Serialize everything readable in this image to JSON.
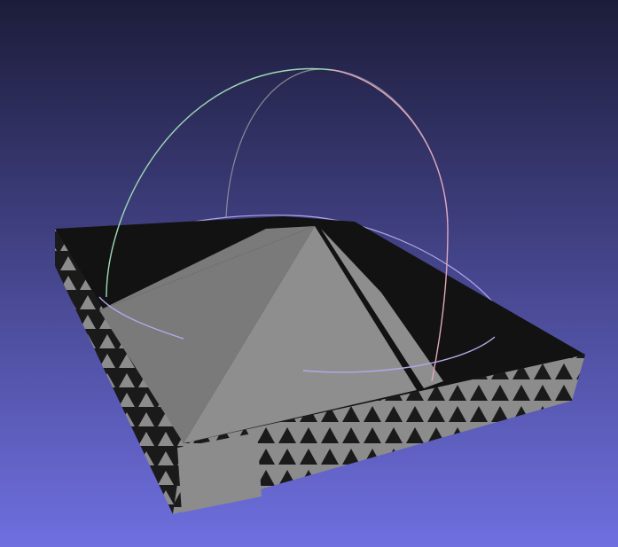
{
  "viewer": {
    "background_gradient_top": "#1c1c3a",
    "background_gradient_bottom": "#6f6fe0"
  },
  "model": {
    "top_face_color": "#121212",
    "pyramid_left_color": "#7a7a7a",
    "pyramid_right_color": "#8e8e8e",
    "side_light_color": "#8c8c8c",
    "side_dark_color": "#1a1a1a"
  },
  "trackball": {
    "ring_green_color": "#9ed9b4",
    "ring_red_color": "#e2a7bd",
    "ring_blue_color": "#b3a7e8",
    "ring_gray_color": "#8a8a9a"
  }
}
